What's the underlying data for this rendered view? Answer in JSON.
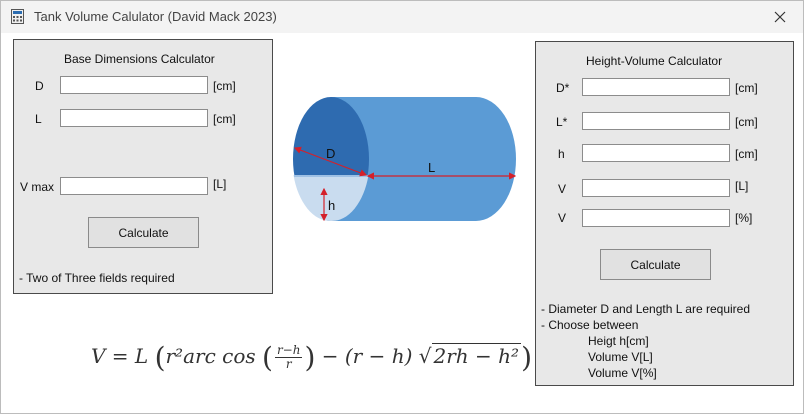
{
  "window": {
    "title": "Tank Volume Calulator (David Mack 2023)"
  },
  "icons": {
    "app": "calculator-icon",
    "close": "close-icon"
  },
  "base_panel": {
    "title": "Base Dimensions Calculator",
    "fields": [
      {
        "label": "D",
        "value": "",
        "unit": "[cm]"
      },
      {
        "label": "L",
        "value": "",
        "unit": "[cm]"
      },
      {
        "label": "V max",
        "value": "",
        "unit": "[L]"
      }
    ],
    "button": "Calculate",
    "note": "- Two of Three fields required"
  },
  "diagram": {
    "label_d": "D",
    "label_l": "L",
    "label_h": "h"
  },
  "hv_panel": {
    "title": "Height-Volume Calculator",
    "fields": [
      {
        "label": "D*",
        "value": "",
        "unit": "[cm]"
      },
      {
        "label": "L*",
        "value": "",
        "unit": "[cm]"
      },
      {
        "label": "h",
        "value": "",
        "unit": "[cm]"
      },
      {
        "label": "V",
        "value": "",
        "unit": "[L]"
      },
      {
        "label": "V",
        "value": "",
        "unit": "[%]"
      }
    ],
    "button": "Calculate",
    "notes": [
      "- Diameter D and Length L are required",
      "- Choose between",
      "Heigt h[cm]",
      "Volume V[L]",
      "Volume V[%]"
    ]
  },
  "formula": {
    "lhs": "V = L",
    "term1": "r²arc cos",
    "frac_num": "r−h",
    "frac_den": "r",
    "term2": "− (r − h)",
    "sqrt_body": "2rh − h²"
  }
}
